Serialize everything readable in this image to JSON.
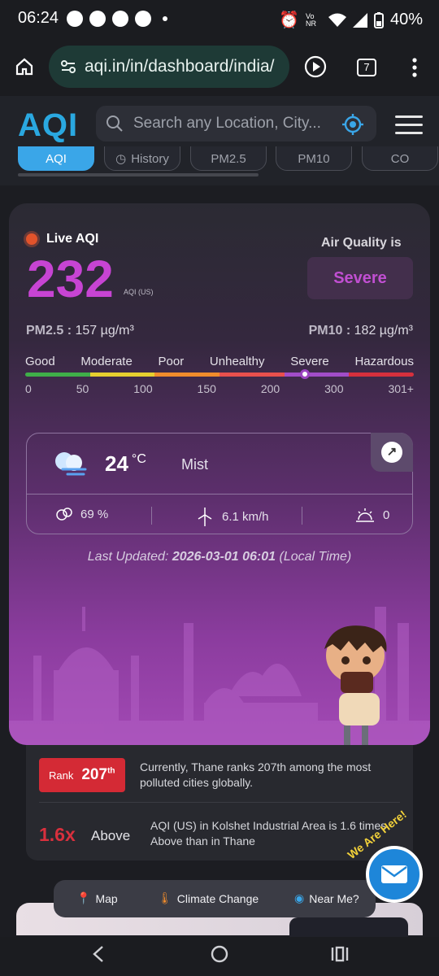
{
  "status_bar": {
    "time": "06:24",
    "battery": "40%",
    "network": "Vo LTE NR"
  },
  "browser": {
    "url": "aqi.in/in/dashboard/india/",
    "tab_count": "7"
  },
  "site": {
    "logo": "AQI",
    "search_placeholder": "Search any Location, City...",
    "tabs": [
      {
        "label": "AQI"
      },
      {
        "label": "History"
      },
      {
        "label": "PM2.5"
      },
      {
        "label": "PM10"
      },
      {
        "label": "CO"
      }
    ]
  },
  "aqi_card": {
    "live_label": "Live AQI",
    "aqi_value": "232",
    "aqi_unit": "AQI (US)",
    "quality_label": "Air Quality is",
    "quality_value": "Severe",
    "pm25_label": "PM2.5 :",
    "pm25_value": "157 µg/m³",
    "pm10_label": "PM10 :",
    "pm10_value": "182 µg/m³",
    "scale_labels": [
      "Good",
      "Moderate",
      "Poor",
      "Unhealthy",
      "Severe",
      "Hazardous"
    ],
    "scale_numbers": [
      "0",
      "50",
      "100",
      "150",
      "200",
      "300",
      "301+"
    ],
    "scale_colors": [
      "#3fae49",
      "#e6cf2f",
      "#f08c2c",
      "#e8504d",
      "#a14dc8",
      "#d6303d"
    ],
    "weather": {
      "temp": "24",
      "temp_unit": "°C",
      "condition": "Mist",
      "humidity": "69 %",
      "wind": "6.1 km/h",
      "uv": "0"
    },
    "last_updated_prefix": "Last Updated:",
    "last_updated_time": "2026-03-01 06:01",
    "last_updated_suffix": "(Local Time)"
  },
  "rank": {
    "label": "Rank",
    "value": "207",
    "suffix": "th",
    "text": "Currently, Thane ranks 207th among the most polluted cities globally."
  },
  "comparison": {
    "multiplier": "1.6x",
    "direction": "Above",
    "text": "AQI (US) in Kolshet Industrial Area is 1.6 times Above than in Thane"
  },
  "float_nav": {
    "map": "Map",
    "climate": "Climate Change",
    "near": "Near Me?"
  },
  "contact": {
    "badge": "We Are Here!"
  }
}
